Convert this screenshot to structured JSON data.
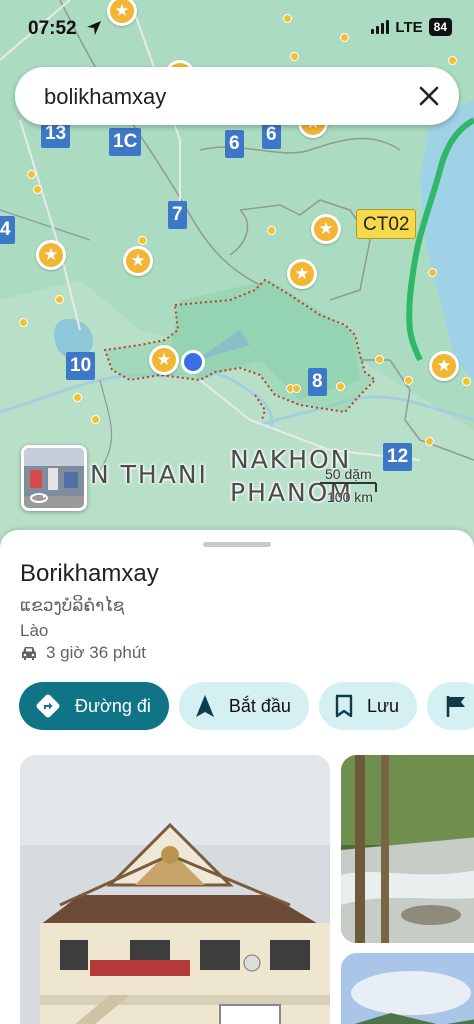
{
  "status_bar": {
    "time": "07:52",
    "network": "LTE",
    "battery": "84"
  },
  "search": {
    "query": "bolikhamxay"
  },
  "map": {
    "route_badges": [
      "13",
      "1C",
      "6",
      "6",
      "7",
      "4",
      "10",
      "8",
      "12"
    ],
    "highway_badge": "CT02",
    "area_labels": {
      "left": "N THANI",
      "right_line1": "NAKHON",
      "right_line2": "PHANOM"
    },
    "scale": {
      "top": "50 dặm",
      "bottom": "100 km"
    }
  },
  "place": {
    "name": "Borikhamxay",
    "native_name": "ແຂວງບໍລິຄຳໄຊ",
    "country": "Lào",
    "drive_time": "3 giờ 36 phút"
  },
  "actions": {
    "directions": "Đường đi",
    "start": "Bắt đầu",
    "save": "Lưu"
  },
  "colors": {
    "primary": "#0e7486",
    "chip": "#d5f0f3",
    "map_land": "#a9dcc0",
    "boundary": "#c0392b"
  }
}
